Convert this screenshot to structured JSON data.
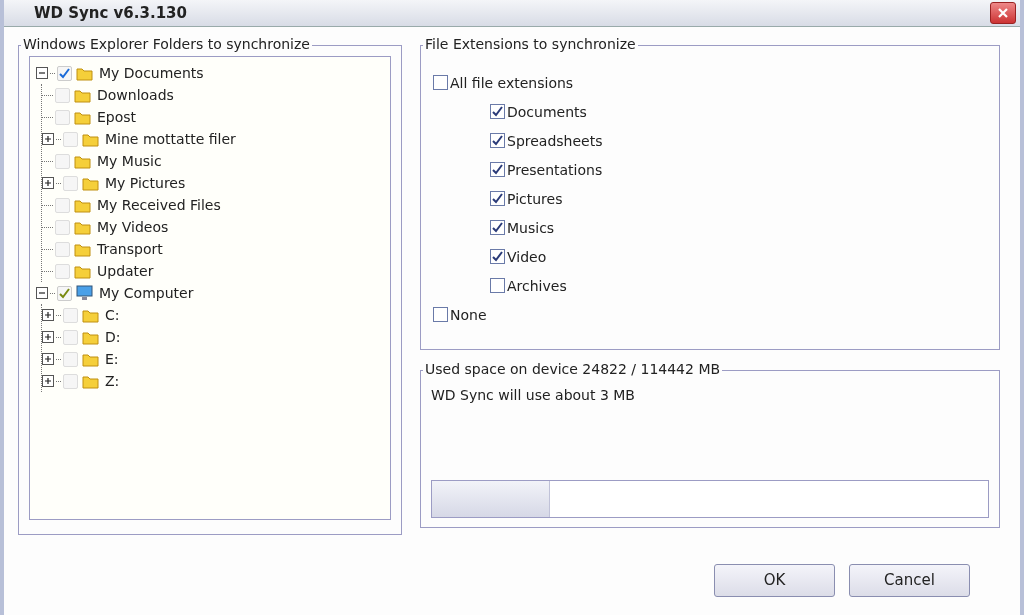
{
  "window": {
    "title": "WD Sync v6.3.130"
  },
  "folders": {
    "title": "Windows Explorer Folders to synchronize",
    "tree": [
      {
        "label": "My Documents",
        "kind": "folder",
        "checked": true,
        "expanded": true,
        "children": [
          {
            "label": "Downloads",
            "kind": "folder",
            "checked": false
          },
          {
            "label": "Epost",
            "kind": "folder",
            "checked": false
          },
          {
            "label": "Mine mottatte filer",
            "kind": "folder",
            "checked": false,
            "expanded": false
          },
          {
            "label": "My Music",
            "kind": "folder",
            "checked": false
          },
          {
            "label": "My Pictures",
            "kind": "folder",
            "checked": false,
            "expanded": false
          },
          {
            "label": "My Received Files",
            "kind": "folder",
            "checked": false
          },
          {
            "label": "My Videos",
            "kind": "folder",
            "checked": false
          },
          {
            "label": "Transport",
            "kind": "folder",
            "checked": false
          },
          {
            "label": "Updater",
            "kind": "folder",
            "checked": false
          }
        ]
      },
      {
        "label": "My Computer",
        "kind": "computer",
        "checked": true,
        "expanded": true,
        "children": [
          {
            "label": "C:",
            "kind": "folder",
            "checked": false,
            "expanded": false
          },
          {
            "label": "D:",
            "kind": "folder",
            "checked": false,
            "expanded": false
          },
          {
            "label": "E:",
            "kind": "folder",
            "checked": false,
            "expanded": false
          },
          {
            "label": "Z:",
            "kind": "folder",
            "checked": false,
            "expanded": false
          }
        ]
      }
    ]
  },
  "extensions": {
    "title": "File Extensions to synchronize",
    "options": [
      {
        "label": "All file extensions",
        "kind": "group",
        "checked": false
      },
      {
        "label": "Documents",
        "kind": "type",
        "checked": true
      },
      {
        "label": "Spreadsheets",
        "kind": "type",
        "checked": true
      },
      {
        "label": "Presentations",
        "kind": "type",
        "checked": true
      },
      {
        "label": "Pictures",
        "kind": "type",
        "checked": true
      },
      {
        "label": "Musics",
        "kind": "type",
        "checked": true
      },
      {
        "label": "Video",
        "kind": "type",
        "checked": true
      },
      {
        "label": "Archives",
        "kind": "type",
        "checked": false
      },
      {
        "label": "None",
        "kind": "group",
        "checked": false
      }
    ]
  },
  "space": {
    "title": "Used space on device 24822 / 114442 MB",
    "message": "WD Sync will use about 3 MB",
    "level": 0.21
  },
  "buttons": [
    "OK",
    "Cancel"
  ]
}
